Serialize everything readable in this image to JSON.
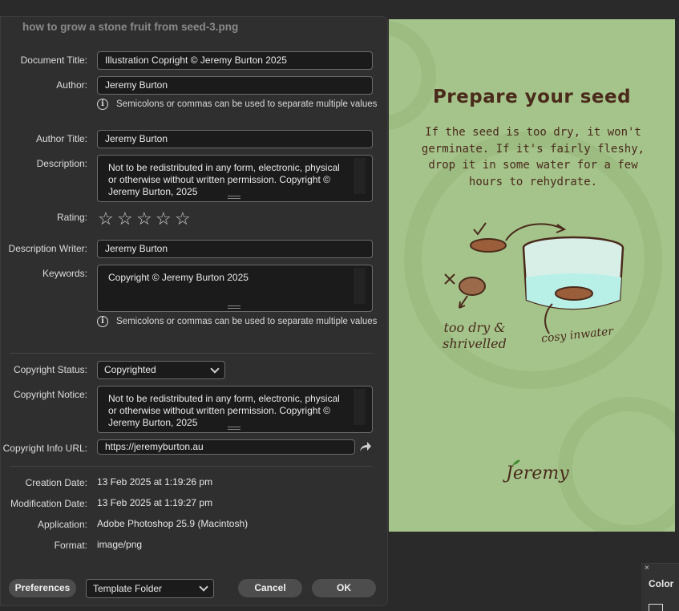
{
  "dialog": {
    "title": "how to grow a stone fruit from seed-3.png",
    "labels": {
      "document_title": "Document Title:",
      "author": "Author:",
      "author_title": "Author Title:",
      "description": "Description:",
      "rating": "Rating:",
      "description_writer": "Description Writer:",
      "keywords": "Keywords:",
      "copyright_status": "Copyright Status:",
      "copyright_notice": "Copyright Notice:",
      "copyright_info_url": "Copyright Info URL:",
      "creation_date": "Creation Date:",
      "modification_date": "Modification Date:",
      "application": "Application:",
      "format": "Format:"
    },
    "values": {
      "document_title": "Illustration Copright © Jeremy Burton 2025",
      "author": "Jeremy Burton",
      "author_title": "Jeremy Burton",
      "description": "Not to be redistributed in any form, electronic, physical or otherwise without written permission. Copyright © Jeremy Burton, 2025",
      "rating": 0,
      "description_writer": "Jeremy Burton",
      "keywords": "Copyright © Jeremy Burton 2025",
      "copyright_status": "Copyrighted",
      "copyright_notice": "Not to be redistributed in any form, electronic, physical or otherwise without written permission. Copyright © Jeremy Burton, 2025",
      "copyright_info_url": "https://jeremyburton.au",
      "creation_date": "13 Feb 2025 at 1:19:26 pm",
      "modification_date": "13 Feb 2025 at 1:19:27 pm",
      "application": "Adobe Photoshop 25.9 (Macintosh)",
      "format": "image/png"
    },
    "hint": "Semicolons or commas can be used to separate multiple values",
    "buttons": {
      "preferences": "Preferences",
      "template_folder": "Template Folder",
      "cancel": "Cancel",
      "ok": "OK"
    }
  },
  "artwork": {
    "title": "Prepare your seed",
    "body": "If the seed is too dry, it won't germinate. If it's fairly fleshy, drop it in some water for a few hours to rehydrate.",
    "label_dry": "too dry & shrivelled",
    "label_water": "cosy inwater",
    "signature": "Jeremy",
    "colors": {
      "background": "#a5c48b",
      "ink": "#4a2a1b",
      "water": "#b8f0e8"
    }
  },
  "color_panel": {
    "title": "Color",
    "close": "×"
  }
}
